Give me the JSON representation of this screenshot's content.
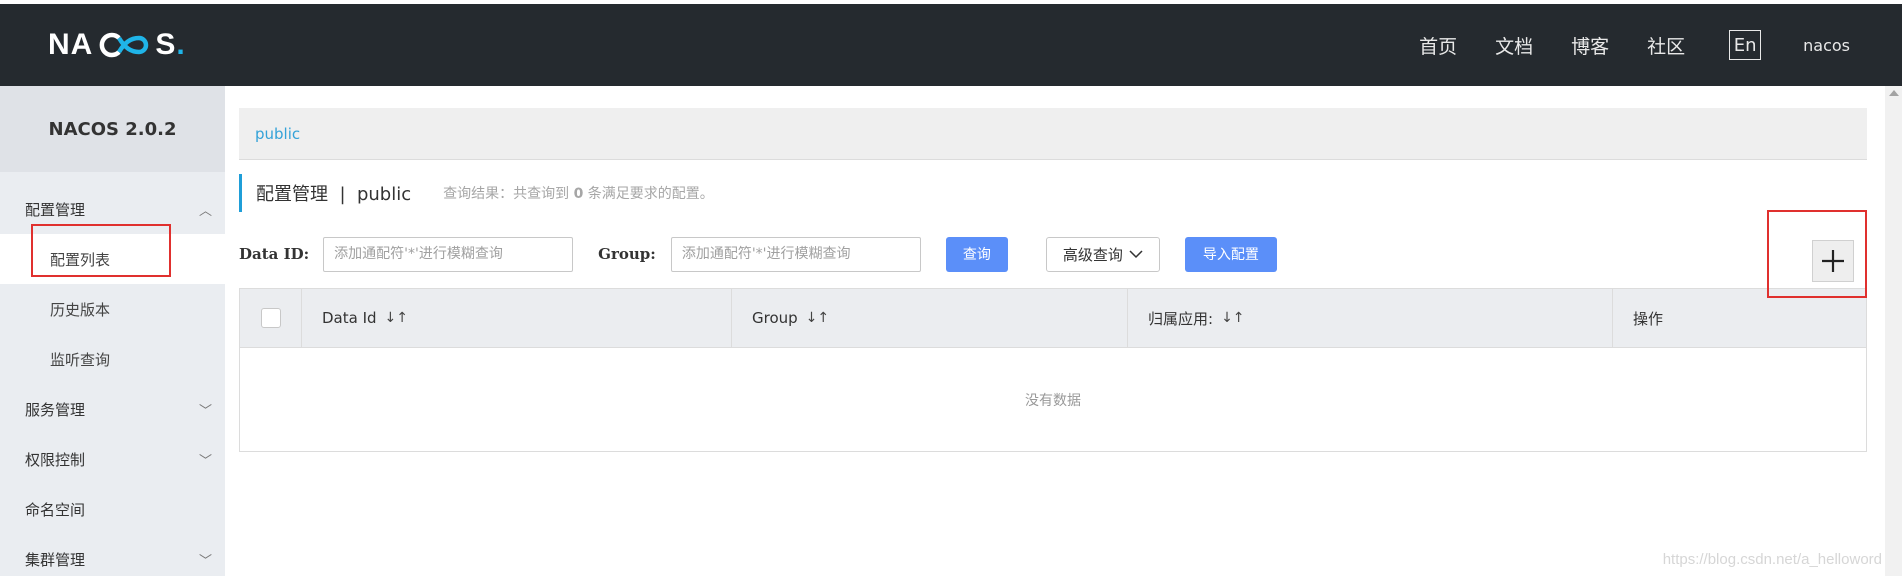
{
  "header": {
    "logo_left": "NA",
    "logo_right": "S",
    "logo_dot": ".",
    "nav": [
      "首页",
      "文档",
      "博客",
      "社区"
    ],
    "lang": "En",
    "user": "nacos"
  },
  "sidebar": {
    "brand": "NACOS 2.0.2",
    "groups": [
      {
        "label": "配置管理",
        "expanded": true,
        "items": [
          "配置列表",
          "历史版本",
          "监听查询"
        ]
      },
      {
        "label": "服务管理",
        "expanded": false
      },
      {
        "label": "权限控制",
        "expanded": false
      },
      {
        "label": "命名空间"
      },
      {
        "label": "集群管理",
        "expanded": false
      }
    ]
  },
  "main": {
    "namespace_tab": "public",
    "title": "配置管理  |  public",
    "result_prefix": "查询结果：共查询到 ",
    "result_count": "0",
    "result_suffix": " 条满足要求的配置。",
    "filters": {
      "data_id_label": "Data ID:",
      "data_id_placeholder": "添加通配符'*'进行模糊查询",
      "group_label": "Group:",
      "group_placeholder": "添加通配符'*'进行模糊查询",
      "query_button": "查询",
      "advanced_button": "高级查询",
      "import_button": "导入配置"
    },
    "table": {
      "columns": [
        "Data Id",
        "Group",
        "归属应用:",
        "操作"
      ],
      "empty_text": "没有数据"
    }
  },
  "watermark": "https://blog.csdn.net/a_helloword",
  "colors": {
    "header_bg": "#252a2f",
    "accent": "#1fb4e8",
    "primary_button": "#5b8ff9",
    "highlight_box": "#e0302e"
  }
}
